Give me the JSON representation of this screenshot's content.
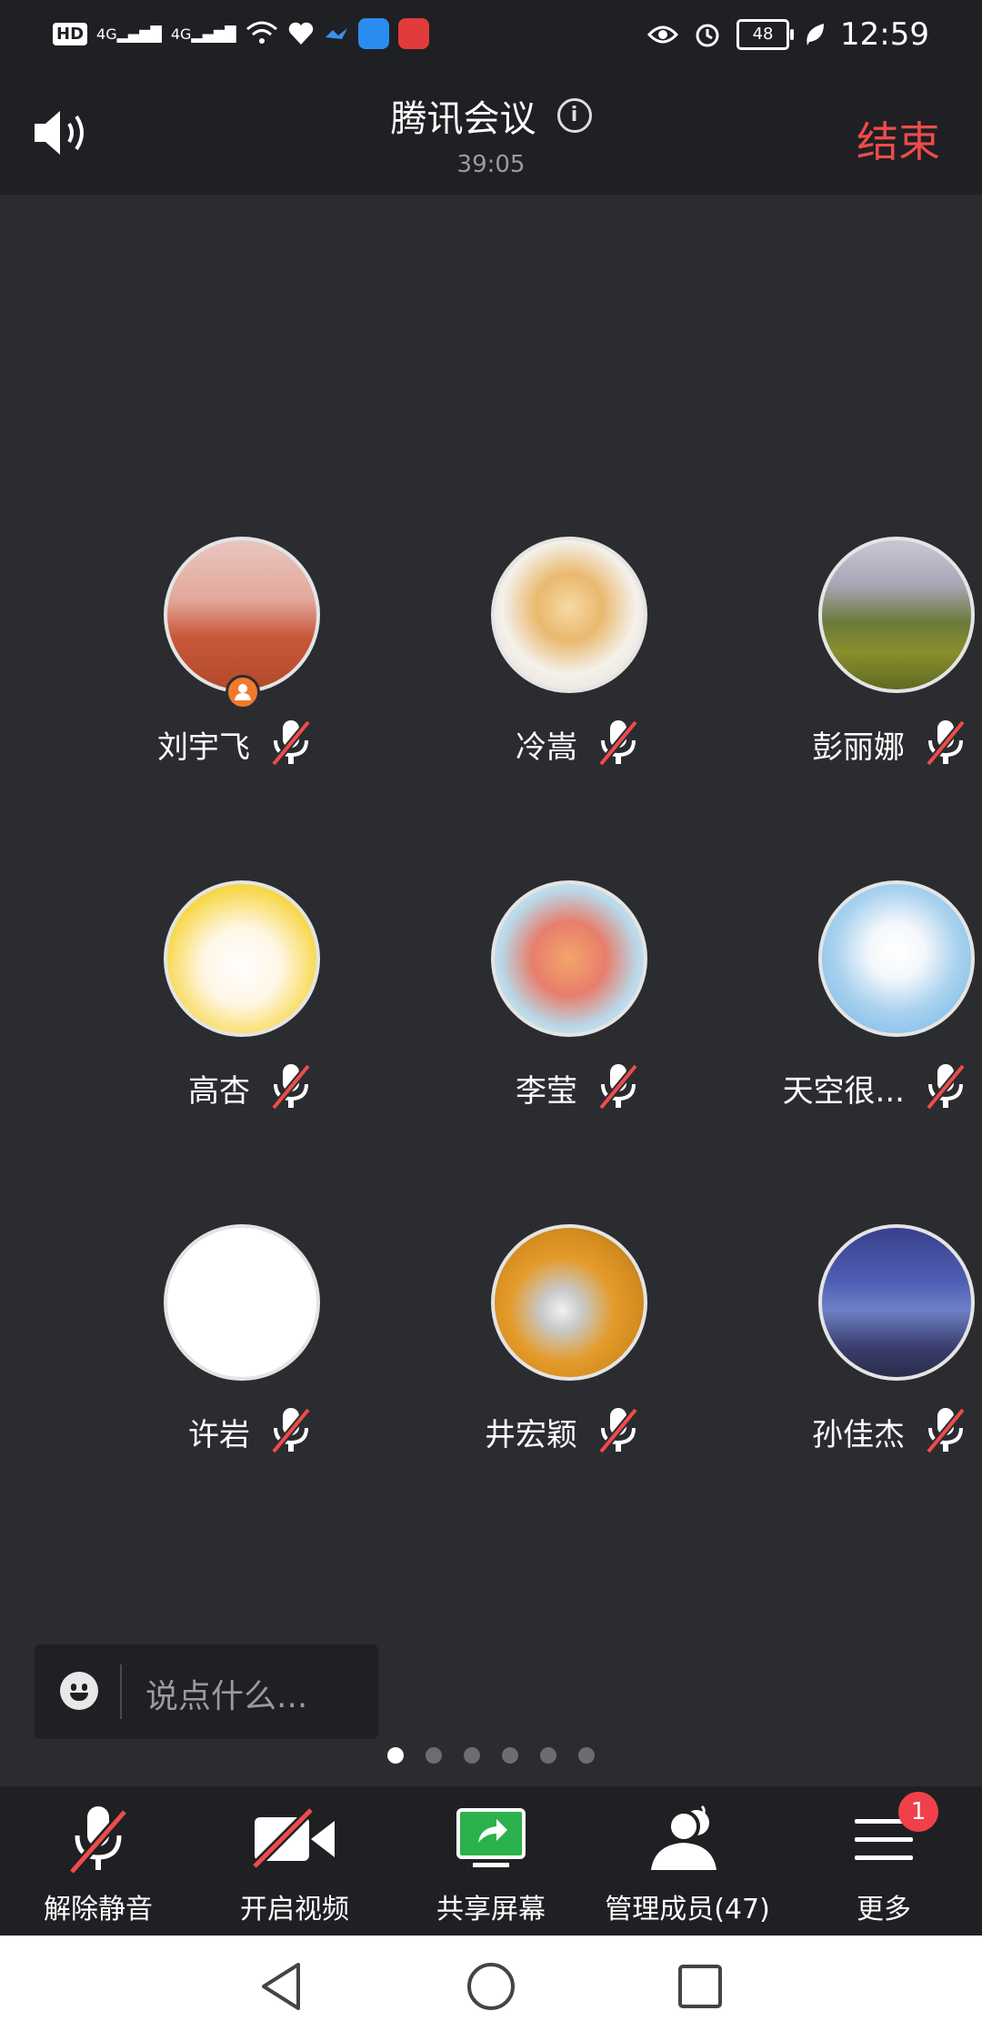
{
  "status_bar": {
    "hd": "HD",
    "sig1": "4G",
    "sig2": "4G",
    "battery": "48",
    "time": "12:59"
  },
  "header": {
    "title": "腾讯会议",
    "timer": "39:05",
    "end_label": "结束"
  },
  "participants": [
    {
      "name": "刘宇飞",
      "host": true
    },
    {
      "name": "冷嵩"
    },
    {
      "name": "彭丽娜"
    },
    {
      "name": "高杏"
    },
    {
      "name": "李莹"
    },
    {
      "name": "天空很..."
    },
    {
      "name": "许岩"
    },
    {
      "name": "井宏颖"
    },
    {
      "name": "孙佳杰"
    }
  ],
  "chat": {
    "placeholder": "说点什么..."
  },
  "pager": {
    "total": 6,
    "active": 1
  },
  "toolbar": {
    "unmute": "解除静音",
    "video": "开启视频",
    "share": "共享屏幕",
    "members": "管理成员(47)",
    "more": "更多",
    "more_badge": "1"
  },
  "colors": {
    "accent_red": "#ee4b4b",
    "share_green": "#2bb24c",
    "host_orange": "#f07a2c"
  }
}
